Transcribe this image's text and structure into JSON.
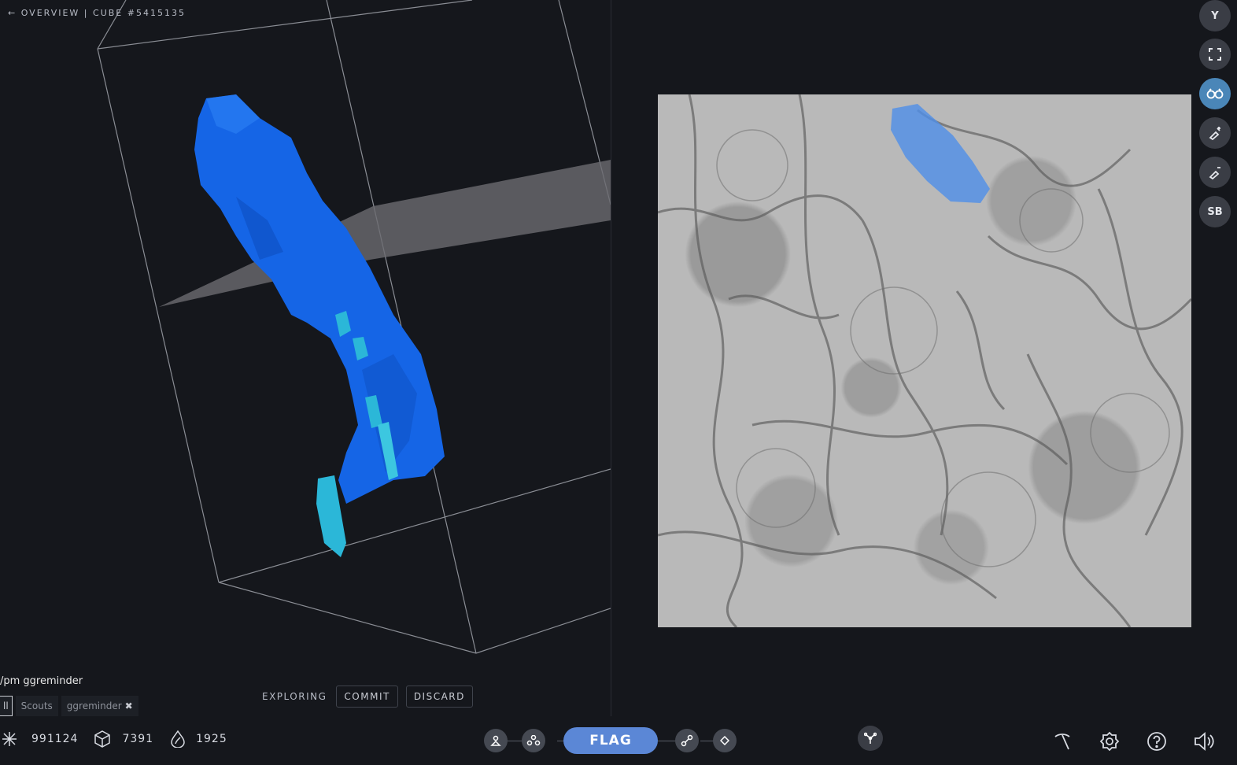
{
  "nav": {
    "back_arrow": "←",
    "overview": "OVERVIEW",
    "separator": "|",
    "cube_label": "CUBE #5415135"
  },
  "sidebar": {
    "buttons": [
      {
        "label": "Y",
        "icon": "user-initial"
      },
      {
        "label": "",
        "icon": "fullscreen-icon"
      },
      {
        "label": "",
        "icon": "binoculars-icon",
        "active": true
      },
      {
        "label": "",
        "icon": "brush-add-icon"
      },
      {
        "label": "",
        "icon": "brush-remove-icon"
      },
      {
        "label": "SB",
        "icon": "user-initial"
      }
    ]
  },
  "chat": {
    "message": "/pm ggreminder",
    "tabs": [
      {
        "label": "ll"
      },
      {
        "label": "Scouts"
      },
      {
        "label": "ggreminder",
        "close": "✖"
      }
    ]
  },
  "explore": {
    "status": "EXPLORING",
    "commit": "COMMIT",
    "discard": "DISCARD"
  },
  "stats": {
    "points": "991124",
    "cubes": "7391",
    "trailblazes": "1925"
  },
  "toolbar": {
    "flag": "FLAG"
  },
  "colors": {
    "accent": "#5b87d6",
    "segment_blue": "#1565e6",
    "segment_cyan": "#2bb7d8",
    "active_tool": "#4a86b8"
  }
}
